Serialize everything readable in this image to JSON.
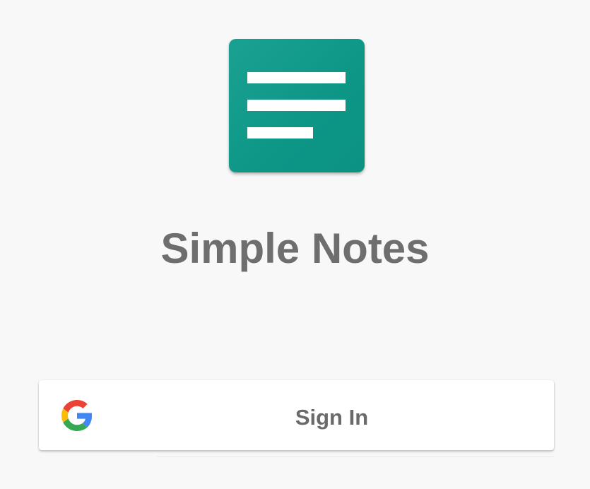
{
  "app": {
    "title": "Simple Notes",
    "logo_icon": "notes-lines-icon",
    "accent_color": "#0e9888"
  },
  "signin": {
    "label": "Sign In",
    "icon": "google-icon",
    "google_colors": [
      "#4285F4",
      "#EA4335",
      "#FBBC05",
      "#34A853"
    ]
  }
}
